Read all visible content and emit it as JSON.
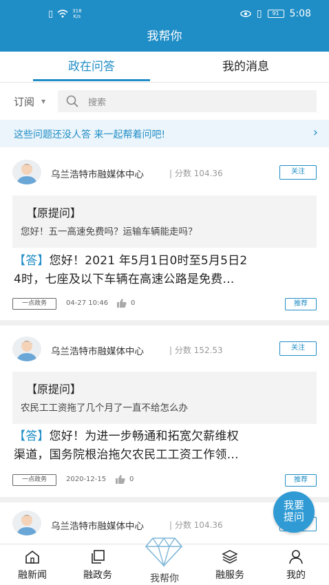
{
  "status_bar": {
    "speed_value": "318",
    "speed_unit": "K/s",
    "battery": "91",
    "time": "5:08"
  },
  "header": {
    "title": "我帮你"
  },
  "tabs": [
    {
      "label": "政在问答",
      "active": true
    },
    {
      "label": "我的消息",
      "active": false
    }
  ],
  "filter": {
    "subscribe_label": "订阅"
  },
  "search": {
    "placeholder": "搜索"
  },
  "banner": {
    "text": "这些问题还没人答 来一起帮着问吧!"
  },
  "cards": [
    {
      "org": "乌兰浩特市融媒体中心",
      "score": "| 分数 104.36",
      "follow_label": "关注",
      "question_title": "【原提问】",
      "question": "您好！五一高速免费吗？运输车辆能走吗？",
      "answer_tag": "【答】",
      "answer_line1": "您好！2021 年5月1日0时至5月5日2",
      "answer_line2": "4时，七座及以下车辆在高速公路是免费…",
      "source": "一点政务",
      "date": "04-27 10:46",
      "likes": "0",
      "recommend_label": "推荐"
    },
    {
      "org": "乌兰浩特市融媒体中心",
      "score": "| 分数 152.53",
      "follow_label": "关注",
      "question_title": "【原提问】",
      "question": "农民工工资拖了几个月了一直不给怎么办",
      "answer_tag": "【答】",
      "answer_line1": "您好！为进一步畅通和拓宽欠薪维权",
      "answer_line2": "渠道，国务院根治拖欠农民工工资工作领…",
      "source": "一点政务",
      "date": "2020-12-15",
      "likes": "0",
      "recommend_label": "推荐"
    },
    {
      "org": "乌兰浩特市融媒体中心",
      "score": "| 分数 104.36",
      "follow_label": "关注"
    }
  ],
  "fab": {
    "line1": "我要",
    "line2": "提问"
  },
  "bottom_nav": [
    {
      "label": "融新闻",
      "icon": "home-icon"
    },
    {
      "label": "融政务",
      "icon": "copy-icon"
    },
    {
      "label": "我帮你",
      "icon": "diamond-icon"
    },
    {
      "label": "融服务",
      "icon": "layers-icon"
    },
    {
      "label": "我的",
      "icon": "user-icon"
    }
  ],
  "colors": {
    "primary": "#1f8dc6",
    "banner_bg": "#ecf5fb"
  }
}
